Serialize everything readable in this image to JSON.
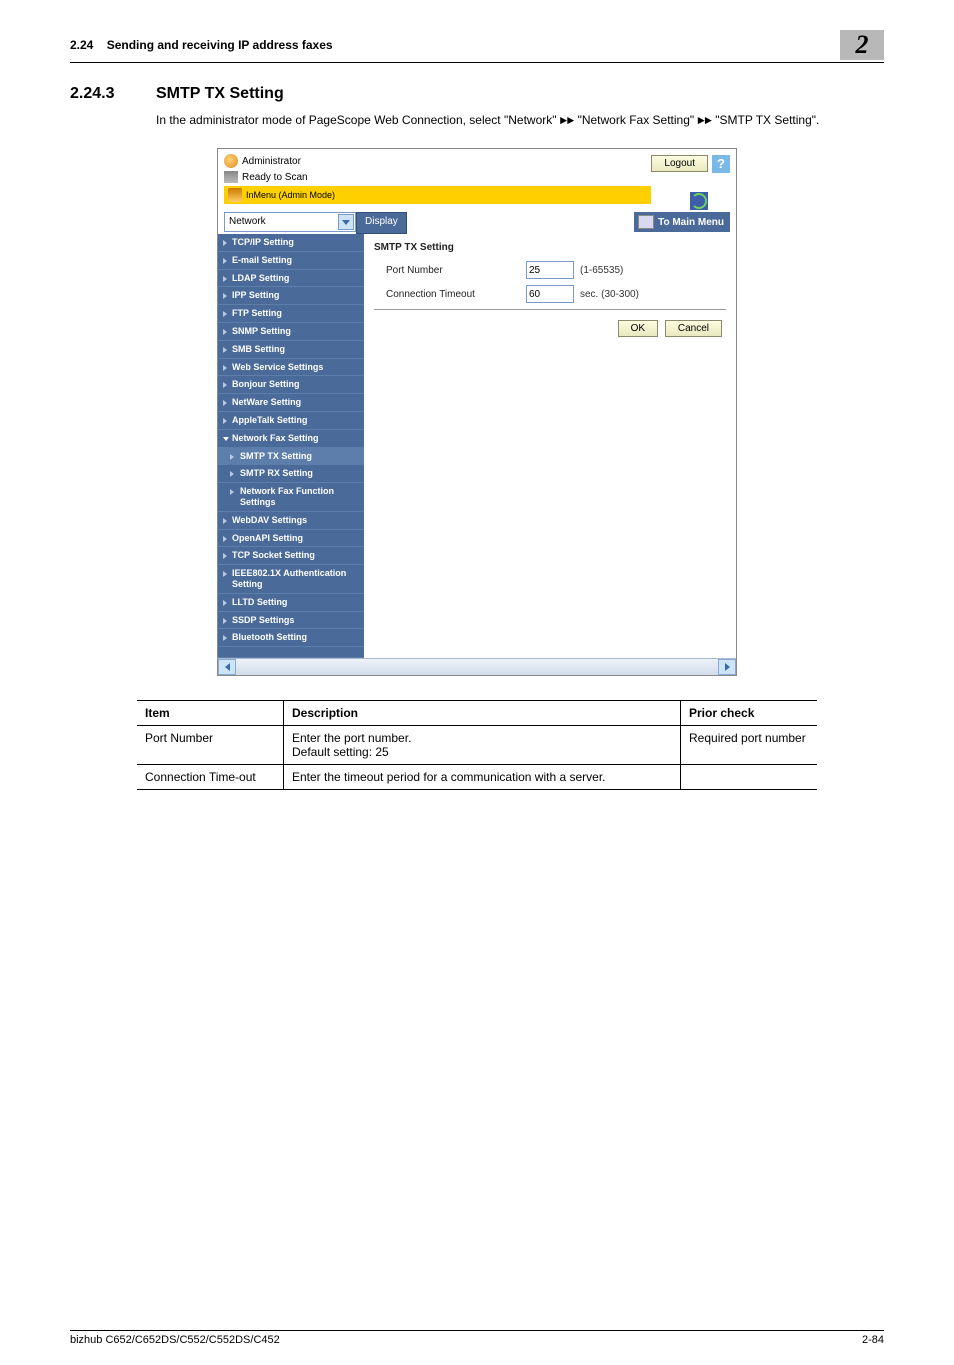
{
  "header": {
    "section_ref": "2.24",
    "section_title": "Sending and receiving IP address faxes",
    "chapter_badge": "2"
  },
  "heading": {
    "number": "2.24.3",
    "title": "SMTP TX Setting"
  },
  "intro": {
    "pre": "In the administrator mode of PageScope Web Connection, select \"Network\" ",
    "mid": " \"Network Fax Setting\" ",
    "post": " \"SMTP TX Setting\".",
    "arrow": "►►"
  },
  "ps": {
    "admin_label": "Administrator",
    "status_label": "Ready to Scan",
    "yellow_label": "InMenu (Admin Mode)",
    "logout": "Logout",
    "help": "?",
    "select_value": "Network",
    "display_btn": "Display",
    "main_menu": "To Main Menu",
    "side_items": [
      "TCP/IP Setting",
      "E-mail Setting",
      "LDAP Setting",
      "IPP Setting",
      "FTP Setting",
      "SNMP Setting",
      "SMB Setting",
      "Web Service Settings",
      "Bonjour Setting",
      "NetWare Setting",
      "AppleTalk Setting"
    ],
    "side_expanded": "Network Fax Setting",
    "side_subs": [
      "SMTP TX Setting",
      "SMTP RX Setting",
      "Network Fax Function Settings"
    ],
    "side_items_after": [
      "WebDAV Settings",
      "OpenAPI Setting",
      "TCP Socket Setting",
      "IEEE802.1X Authentication Setting",
      "LLTD Setting",
      "SSDP Settings",
      "Bluetooth Setting"
    ],
    "content": {
      "title": "SMTP TX Setting",
      "rows": [
        {
          "label": "Port Number",
          "value": "25",
          "hint": "(1-65535)"
        },
        {
          "label": "Connection Timeout",
          "value": "60",
          "hint": "sec. (30-300)"
        }
      ],
      "ok": "OK",
      "cancel": "Cancel"
    }
  },
  "table": {
    "headers": {
      "item": "Item",
      "desc": "Description",
      "prior": "Prior check"
    },
    "rows": [
      {
        "item": "Port Number",
        "desc": "Enter the port number.\nDefault setting: 25",
        "prior": "Required port number"
      },
      {
        "item": "Connection Time-out",
        "desc": "Enter the timeout period for a communication with a server.",
        "prior": ""
      }
    ]
  },
  "footer": {
    "model": "bizhub C652/C652DS/C552/C552DS/C452",
    "page": "2-84"
  }
}
